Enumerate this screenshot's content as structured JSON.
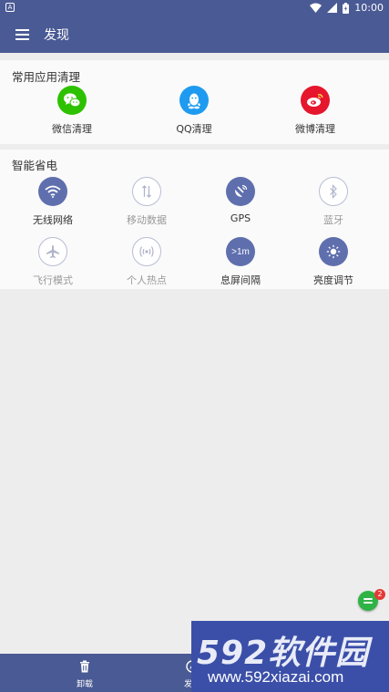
{
  "status_bar": {
    "time": "10:00",
    "left_icon": "a-notification-icon",
    "icons": [
      "wifi-icon",
      "signal-icon",
      "battery-icon"
    ]
  },
  "appbar": {
    "title": "发现",
    "menu_icon": "menu-icon"
  },
  "common_apps": {
    "title": "常用应用清理",
    "items": [
      {
        "label": "微信清理",
        "icon": "wechat-icon",
        "color": "#2dc100"
      },
      {
        "label": "QQ清理",
        "icon": "qq-icon",
        "color": "#1e9bf0"
      },
      {
        "label": "微博清理",
        "icon": "weibo-icon",
        "color": "#e6162d"
      }
    ]
  },
  "power_saving": {
    "title": "智能省电",
    "toggles": [
      {
        "label": "无线网络",
        "icon": "wifi-icon",
        "state": "on"
      },
      {
        "label": "移动数据",
        "icon": "mobile-data-icon",
        "state": "off"
      },
      {
        "label": "GPS",
        "icon": "gps-icon",
        "state": "on"
      },
      {
        "label": "蓝牙",
        "icon": "bluetooth-icon",
        "state": "off"
      },
      {
        "label": "飞行模式",
        "icon": "airplane-icon",
        "state": "off"
      },
      {
        "label": "个人热点",
        "icon": "hotspot-icon",
        "state": "off"
      },
      {
        "label": "息屏间隔",
        "icon": "screen-timeout-icon",
        "icon_text": ">1m",
        "state": "on"
      },
      {
        "label": "亮度调节",
        "icon": "brightness-icon",
        "state": "on"
      }
    ]
  },
  "bottom_nav": {
    "tabs": [
      {
        "label": "卸载",
        "icon": "trash-icon"
      },
      {
        "label": "发现",
        "icon": "discover-icon"
      }
    ]
  },
  "floating": {
    "badge_count": "2",
    "icon": "message-icon"
  },
  "watermark": {
    "logo": "592软件园",
    "url": "www.592xiazai.com"
  },
  "colors": {
    "primary": "#4a5a94",
    "toggle_on": "#5f6fae",
    "background": "#ededed"
  }
}
